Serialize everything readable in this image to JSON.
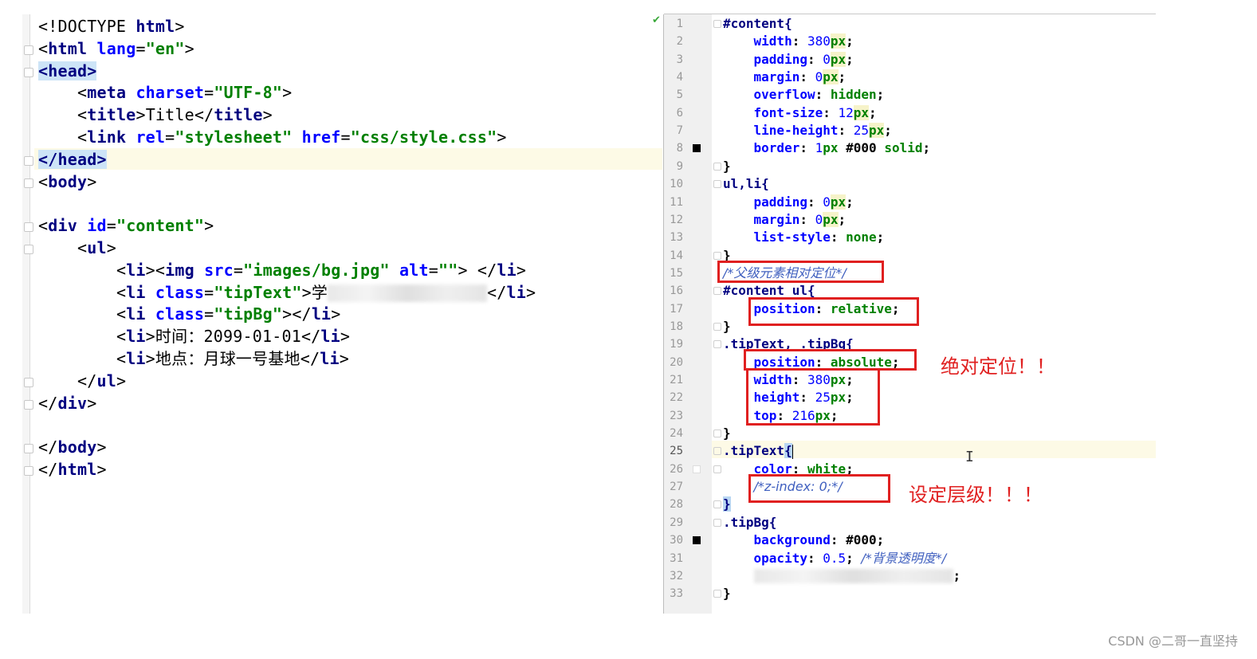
{
  "html_editor": {
    "lines": [
      {
        "parts": [
          [
            "punct",
            "<!"
          ],
          [
            "txt",
            "DOCTYPE "
          ],
          [
            "tag",
            "html"
          ],
          [
            "punct",
            ">"
          ]
        ]
      },
      {
        "parts": [
          [
            "punct",
            "<"
          ],
          [
            "tag",
            "html "
          ],
          [
            "attr",
            "lang"
          ],
          [
            "punct",
            "="
          ],
          [
            "val",
            "\"en\""
          ],
          [
            "punct",
            ">"
          ]
        ]
      },
      {
        "parts": [
          [
            "headbg",
            "<head>"
          ]
        ]
      },
      {
        "parts": [
          [
            "txt",
            "    "
          ],
          [
            "punct",
            "<"
          ],
          [
            "tag",
            "meta "
          ],
          [
            "attr",
            "charset"
          ],
          [
            "punct",
            "="
          ],
          [
            "val",
            "\"UTF-8\""
          ],
          [
            "punct",
            ">"
          ]
        ]
      },
      {
        "parts": [
          [
            "txt",
            "    "
          ],
          [
            "punct",
            "<"
          ],
          [
            "tag",
            "title"
          ],
          [
            "punct",
            ">"
          ],
          [
            "txt",
            "Title"
          ],
          [
            "punct",
            "</"
          ],
          [
            "tag",
            "title"
          ],
          [
            "punct",
            ">"
          ]
        ]
      },
      {
        "parts": [
          [
            "txt",
            "    "
          ],
          [
            "punct",
            "<"
          ],
          [
            "tag",
            "link "
          ],
          [
            "attr",
            "rel"
          ],
          [
            "punct",
            "="
          ],
          [
            "val",
            "\"stylesheet\" "
          ],
          [
            "attr",
            "href"
          ],
          [
            "punct",
            "="
          ],
          [
            "val",
            "\"css/style.css\""
          ],
          [
            "punct",
            ">"
          ]
        ]
      },
      {
        "parts": [
          [
            "headbg",
            "</head>"
          ]
        ]
      },
      {
        "parts": [
          [
            "punct",
            "<"
          ],
          [
            "tag",
            "body"
          ],
          [
            "punct",
            ">"
          ]
        ]
      },
      {
        "parts": []
      },
      {
        "parts": [
          [
            "punct",
            "<"
          ],
          [
            "tag",
            "div "
          ],
          [
            "attr",
            "id"
          ],
          [
            "punct",
            "="
          ],
          [
            "val",
            "\"content\""
          ],
          [
            "punct",
            ">"
          ]
        ]
      },
      {
        "parts": [
          [
            "txt",
            "    "
          ],
          [
            "punct",
            "<"
          ],
          [
            "tag",
            "ul"
          ],
          [
            "punct",
            ">"
          ]
        ]
      },
      {
        "parts": [
          [
            "txt",
            "        "
          ],
          [
            "punct",
            "<"
          ],
          [
            "tag",
            "li"
          ],
          [
            "punct",
            "><"
          ],
          [
            "tag",
            "img "
          ],
          [
            "attr",
            "src"
          ],
          [
            "punct",
            "="
          ],
          [
            "val",
            "\"images/bg.jpg\" "
          ],
          [
            "attr",
            "alt"
          ],
          [
            "punct",
            "="
          ],
          [
            "val",
            "\"\""
          ],
          [
            "punct",
            "> </"
          ],
          [
            "tag",
            "li"
          ],
          [
            "punct",
            ">"
          ]
        ]
      },
      {
        "parts": [
          [
            "txt",
            "        "
          ],
          [
            "punct",
            "<"
          ],
          [
            "tag",
            "li "
          ],
          [
            "attr",
            "class"
          ],
          [
            "punct",
            "="
          ],
          [
            "val",
            "\"tipText\""
          ],
          [
            "punct",
            ">"
          ],
          [
            "txt",
            "学"
          ],
          [
            "blur",
            ""
          ],
          [
            "punct",
            "</"
          ],
          [
            "tag",
            "li"
          ],
          [
            "punct",
            ">"
          ]
        ]
      },
      {
        "parts": [
          [
            "txt",
            "        "
          ],
          [
            "punct",
            "<"
          ],
          [
            "tag",
            "li "
          ],
          [
            "attr",
            "class"
          ],
          [
            "punct",
            "="
          ],
          [
            "val",
            "\"tipBg\""
          ],
          [
            "punct",
            "></"
          ],
          [
            "tag",
            "li"
          ],
          [
            "punct",
            ">"
          ]
        ]
      },
      {
        "parts": [
          [
            "txt",
            "        "
          ],
          [
            "punct",
            "<"
          ],
          [
            "tag",
            "li"
          ],
          [
            "punct",
            ">"
          ],
          [
            "txt",
            "时间：2099-01-01"
          ],
          [
            "punct",
            "</"
          ],
          [
            "tag",
            "li"
          ],
          [
            "punct",
            ">"
          ]
        ]
      },
      {
        "parts": [
          [
            "txt",
            "        "
          ],
          [
            "punct",
            "<"
          ],
          [
            "tag",
            "li"
          ],
          [
            "punct",
            ">"
          ],
          [
            "txt",
            "地点：月球一号基地"
          ],
          [
            "punct",
            "</"
          ],
          [
            "tag",
            "li"
          ],
          [
            "punct",
            ">"
          ]
        ]
      },
      {
        "parts": [
          [
            "txt",
            "    "
          ],
          [
            "punct",
            "</"
          ],
          [
            "tag",
            "ul"
          ],
          [
            "punct",
            ">"
          ]
        ]
      },
      {
        "parts": [
          [
            "punct",
            "</"
          ],
          [
            "tag",
            "div"
          ],
          [
            "punct",
            ">"
          ]
        ]
      },
      {
        "parts": []
      },
      {
        "parts": [
          [
            "punct",
            "</"
          ],
          [
            "tag",
            "body"
          ],
          [
            "punct",
            ">"
          ]
        ]
      },
      {
        "parts": [
          [
            "punct",
            "</"
          ],
          [
            "tag",
            "html"
          ],
          [
            "punct",
            ">"
          ]
        ]
      }
    ]
  },
  "css_editor": {
    "lines": [
      {
        "n": "1",
        "parts": [
          [
            "sel",
            "#content{"
          ]
        ]
      },
      {
        "n": "2",
        "parts": [
          [
            "plain",
            "    "
          ],
          [
            "prop",
            "width"
          ],
          [
            "plain",
            ": "
          ],
          [
            "num",
            "380"
          ],
          [
            "unit",
            "px"
          ],
          [
            "plain",
            ";"
          ]
        ]
      },
      {
        "n": "3",
        "parts": [
          [
            "plain",
            "    "
          ],
          [
            "prop",
            "padding"
          ],
          [
            "plain",
            ": "
          ],
          [
            "num",
            "0"
          ],
          [
            "unit",
            "px"
          ],
          [
            "plain",
            ";"
          ]
        ]
      },
      {
        "n": "4",
        "parts": [
          [
            "plain",
            "    "
          ],
          [
            "prop",
            "margin"
          ],
          [
            "plain",
            ": "
          ],
          [
            "num",
            "0"
          ],
          [
            "unit",
            "px"
          ],
          [
            "plain",
            ";"
          ]
        ]
      },
      {
        "n": "5",
        "parts": [
          [
            "plain",
            "    "
          ],
          [
            "prop",
            "overflow"
          ],
          [
            "plain",
            ": "
          ],
          [
            "kw",
            "hidden"
          ],
          [
            "plain",
            ";"
          ]
        ]
      },
      {
        "n": "6",
        "parts": [
          [
            "plain",
            "    "
          ],
          [
            "prop",
            "font-size"
          ],
          [
            "plain",
            ": "
          ],
          [
            "num",
            "12"
          ],
          [
            "unit",
            "px"
          ],
          [
            "plain",
            ";"
          ]
        ]
      },
      {
        "n": "7",
        "parts": [
          [
            "plain",
            "    "
          ],
          [
            "prop",
            "line-height"
          ],
          [
            "plain",
            ": "
          ],
          [
            "num",
            "25"
          ],
          [
            "unit",
            "px"
          ],
          [
            "plain",
            ";"
          ]
        ]
      },
      {
        "n": "8",
        "parts": [
          [
            "plain",
            "    "
          ],
          [
            "prop",
            "border"
          ],
          [
            "plain",
            ": "
          ],
          [
            "num",
            "1"
          ],
          [
            "kw",
            "px "
          ],
          [
            "plain",
            "#000 "
          ],
          [
            "kw",
            "solid"
          ],
          [
            "plain",
            ";"
          ]
        ]
      },
      {
        "n": "9",
        "parts": [
          [
            "plain",
            "}"
          ]
        ]
      },
      {
        "n": "10",
        "parts": [
          [
            "sel",
            "ul,li{"
          ]
        ]
      },
      {
        "n": "11",
        "parts": [
          [
            "plain",
            "    "
          ],
          [
            "prop",
            "padding"
          ],
          [
            "plain",
            ": "
          ],
          [
            "num",
            "0"
          ],
          [
            "unit",
            "px"
          ],
          [
            "plain",
            ";"
          ]
        ]
      },
      {
        "n": "12",
        "parts": [
          [
            "plain",
            "    "
          ],
          [
            "prop",
            "margin"
          ],
          [
            "plain",
            ": "
          ],
          [
            "num",
            "0"
          ],
          [
            "unit",
            "px"
          ],
          [
            "plain",
            ";"
          ]
        ]
      },
      {
        "n": "13",
        "parts": [
          [
            "plain",
            "    "
          ],
          [
            "prop",
            "list-style"
          ],
          [
            "plain",
            ": "
          ],
          [
            "kw",
            "none"
          ],
          [
            "plain",
            ";"
          ]
        ]
      },
      {
        "n": "14",
        "parts": [
          [
            "plain",
            "}"
          ]
        ]
      },
      {
        "n": "15",
        "parts": [
          [
            "cm",
            "/*父级元素相对定位*/"
          ]
        ]
      },
      {
        "n": "16",
        "parts": [
          [
            "sel",
            "#content ul{"
          ]
        ]
      },
      {
        "n": "17",
        "parts": [
          [
            "plain",
            "    "
          ],
          [
            "prop",
            "position"
          ],
          [
            "plain",
            ": "
          ],
          [
            "kw",
            "relative"
          ],
          [
            "plain",
            ";"
          ]
        ]
      },
      {
        "n": "18",
        "parts": [
          [
            "plain",
            "}"
          ]
        ]
      },
      {
        "n": "19",
        "parts": [
          [
            "sel",
            ".tipText, .tipBg{"
          ]
        ]
      },
      {
        "n": "20",
        "parts": [
          [
            "plain",
            "    "
          ],
          [
            "prop",
            "position"
          ],
          [
            "plain",
            ": "
          ],
          [
            "kw",
            "absolute"
          ],
          [
            "plain",
            ";"
          ]
        ]
      },
      {
        "n": "21",
        "parts": [
          [
            "plain",
            "    "
          ],
          [
            "prop",
            "width"
          ],
          [
            "plain",
            ": "
          ],
          [
            "num",
            "380"
          ],
          [
            "kw",
            "px"
          ],
          [
            "plain",
            ";"
          ]
        ]
      },
      {
        "n": "22",
        "parts": [
          [
            "plain",
            "    "
          ],
          [
            "prop",
            "height"
          ],
          [
            "plain",
            ": "
          ],
          [
            "num",
            "25"
          ],
          [
            "kw",
            "px"
          ],
          [
            "plain",
            ";"
          ]
        ]
      },
      {
        "n": "23",
        "parts": [
          [
            "plain",
            "    "
          ],
          [
            "prop",
            "top"
          ],
          [
            "plain",
            ": "
          ],
          [
            "num",
            "216"
          ],
          [
            "kw",
            "px"
          ],
          [
            "plain",
            ";"
          ]
        ]
      },
      {
        "n": "24",
        "parts": [
          [
            "plain",
            "}"
          ]
        ]
      },
      {
        "n": "25",
        "parts": [
          [
            "sel",
            ".tipText"
          ],
          [
            "brc",
            "{"
          ],
          [
            "caret",
            ""
          ]
        ]
      },
      {
        "n": "26",
        "parts": [
          [
            "plain",
            "    "
          ],
          [
            "prop",
            "color"
          ],
          [
            "plain",
            ": "
          ],
          [
            "kw",
            "white"
          ],
          [
            "plain",
            ";"
          ]
        ]
      },
      {
        "n": "27",
        "parts": [
          [
            "plain",
            "    "
          ],
          [
            "cm",
            "/*z-index: 0;*/"
          ]
        ]
      },
      {
        "n": "28",
        "parts": [
          [
            "brc",
            "}"
          ]
        ]
      },
      {
        "n": "29",
        "parts": [
          [
            "sel",
            ".tipBg{"
          ]
        ]
      },
      {
        "n": "30",
        "parts": [
          [
            "plain",
            "    "
          ],
          [
            "prop",
            "background"
          ],
          [
            "plain",
            ": "
          ],
          [
            "plain",
            "#000"
          ],
          [
            "plain",
            ";"
          ]
        ]
      },
      {
        "n": "31",
        "parts": [
          [
            "plain",
            "    "
          ],
          [
            "prop",
            "opacity"
          ],
          [
            "plain",
            ": "
          ],
          [
            "num",
            "0.5"
          ],
          [
            "plain",
            "; "
          ],
          [
            "cm",
            "/*背景透明度*/"
          ]
        ]
      },
      {
        "n": "32",
        "parts": [
          [
            "plain",
            "    "
          ],
          [
            "blur",
            ""
          ],
          [
            "plain",
            ";"
          ]
        ]
      },
      {
        "n": "33",
        "parts": [
          [
            "plain",
            "}"
          ]
        ]
      }
    ]
  },
  "annotations": {
    "absolute_note": "绝对定位！！",
    "zindex_note": "设定层级！！！"
  },
  "watermark": "CSDN @二哥一直坚持",
  "colors": {
    "annotation_red": "#e02020",
    "current_line": "#fdfae6",
    "tag": "#000080",
    "attribute": "#0000ff",
    "string": "#008000"
  }
}
